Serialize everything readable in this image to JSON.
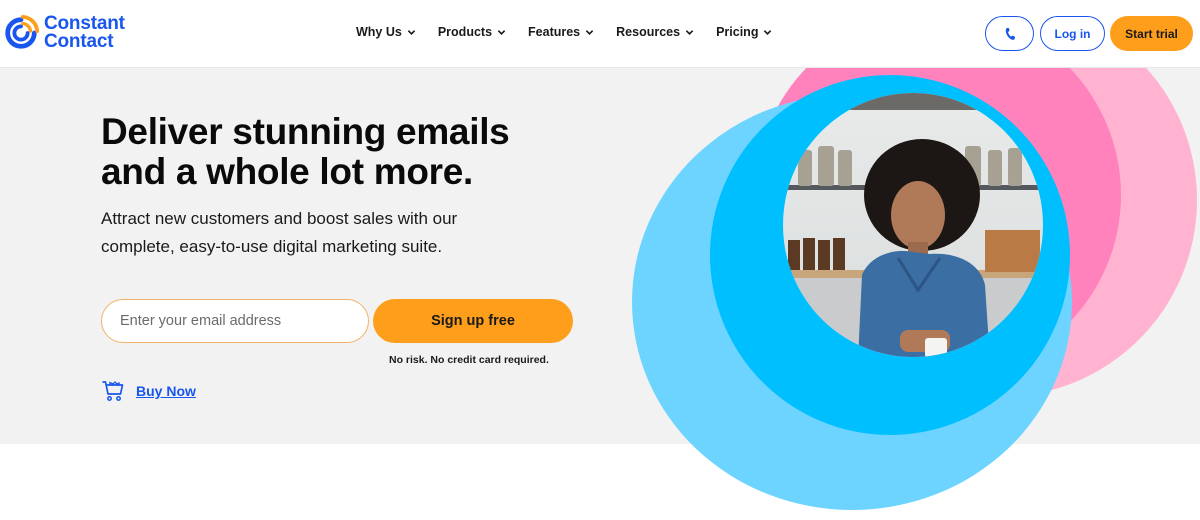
{
  "header": {
    "logo": {
      "line1": "Constant",
      "line2": "Contact",
      "icon": "constant-contact-logo-icon"
    },
    "nav": [
      {
        "label": "Why Us",
        "icon": "chevron-down-icon"
      },
      {
        "label": "Products",
        "icon": "chevron-down-icon"
      },
      {
        "label": "Features",
        "icon": "chevron-down-icon"
      },
      {
        "label": "Resources",
        "icon": "chevron-down-icon"
      },
      {
        "label": "Pricing",
        "icon": "chevron-down-icon"
      }
    ],
    "phone_icon": "phone-icon",
    "login_label": "Log in",
    "trial_label": "Start trial"
  },
  "hero": {
    "headline_line1": "Deliver stunning emails",
    "headline_line2": "and a whole lot more.",
    "subtext_line1": "Attract new customers and boost sales with our",
    "subtext_line2": "complete, easy-to-use digital marketing suite.",
    "email_placeholder": "Enter your email address",
    "email_value": "",
    "signup_label": "Sign up free",
    "disclaimer": "No risk. No credit card required.",
    "buy_now_label": "Buy Now",
    "buy_now_icon": "shopping-cart-icon",
    "image_description": "Woman in denim shirt leaning on counter in front of shelves with jars"
  },
  "colors": {
    "brand_blue": "#1856ed",
    "accent_orange": "#ff9e1b",
    "orange_logo": "#ff9e1b",
    "pink_light": "#ffb3d1",
    "pink": "#ff82bd",
    "blue_light": "#6dd3ff",
    "blue": "#00bfff",
    "hero_bg": "#f2f2f2"
  }
}
